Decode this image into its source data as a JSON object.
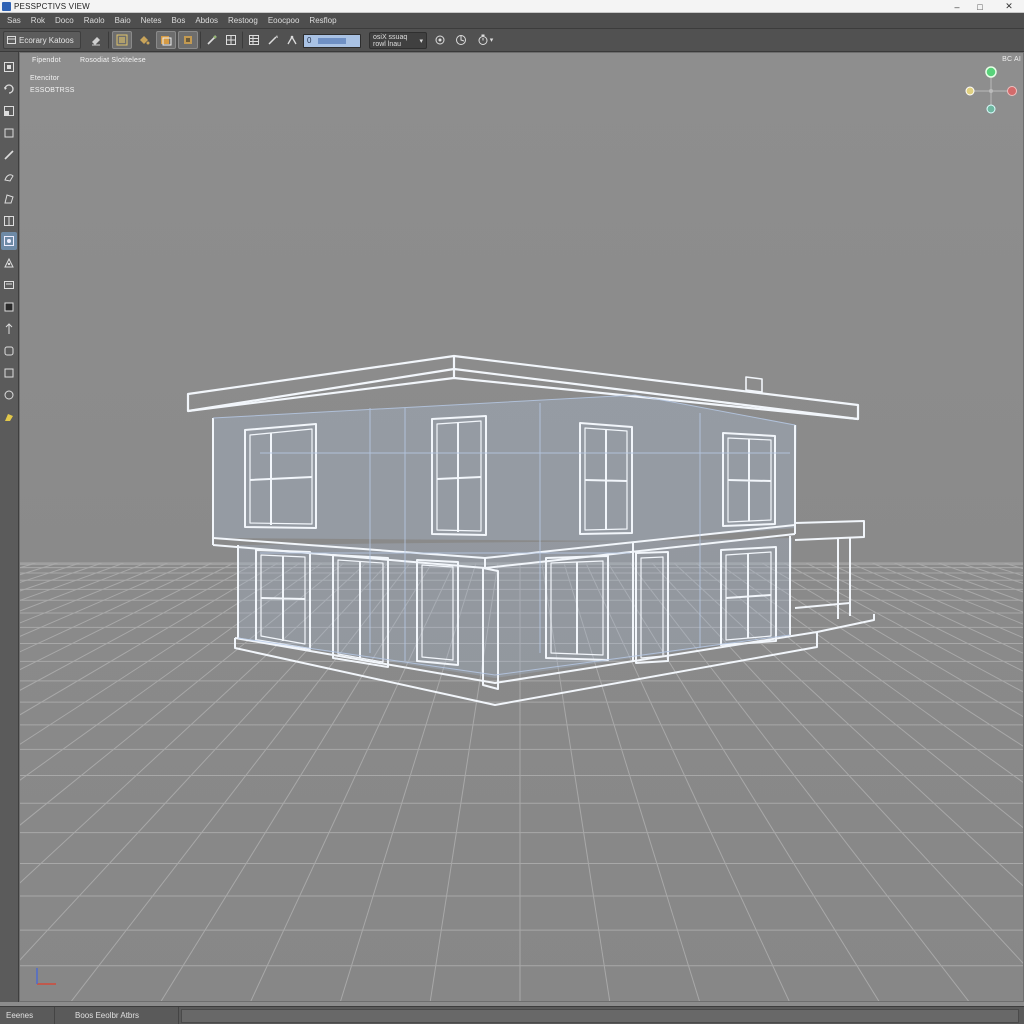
{
  "window": {
    "title": "PESSPCTIVS VIEW",
    "controls": {
      "minimize": "–",
      "maximize": "□",
      "close": "✕"
    }
  },
  "menu": [
    "Sas",
    "Rok",
    "Doco",
    "Raolo",
    "Baio",
    "Netes",
    "Bos",
    "Abdos",
    "Restoog",
    "Eoocpoo",
    "Resflop"
  ],
  "toolbar": {
    "workspace_label": "Ecorary Katoos",
    "input_value": "0",
    "input_fill": 0.7,
    "dropdown_label": "osiX ssuaq\nrowl lnau",
    "buttons": [
      "eraser-icon",
      "grid-select-icon",
      "paint-bucket-icon",
      "layers-icon",
      "box-icon",
      "pencil-icon",
      "snap-grid-icon",
      "stylus-icon",
      "move-tool-icon",
      "orbit-icon",
      "camera-icon",
      "clock-icon"
    ]
  },
  "left_tools": [
    "select-icon",
    "rotate-icon",
    "scale-icon",
    "rectangle-icon",
    "pencil-icon",
    "paint-icon",
    "shape-icon",
    "grid-icon",
    "node-icon",
    "edit-mesh-icon",
    "display-icon",
    "light-icon",
    "scale-object-icon",
    "frame-icon",
    "eye-icon",
    "highlight-icon"
  ],
  "viewport": {
    "mode_label": "Fipendot",
    "shading_label": "Rosodiat Slotitelese",
    "stats": [
      "Etencitor",
      "ESSOBTRSS"
    ],
    "corner_label": "BC AI",
    "grid_color": "#a8a8a8",
    "wire_color": "#f2f6fb",
    "glass_color": "#a8bfe0"
  },
  "statusbar": {
    "left": "Eeenes",
    "mid": "Boos Eeolbr Atbrs"
  }
}
